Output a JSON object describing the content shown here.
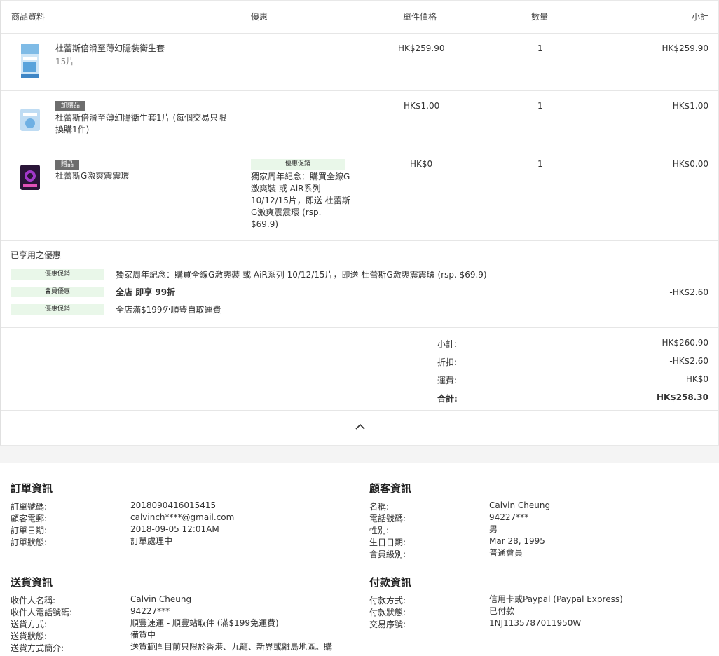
{
  "table_headers": {
    "product": "商品資料",
    "promo": "優惠",
    "unit_price": "單件價格",
    "qty": "數量",
    "subtotal": "小計"
  },
  "items": [
    {
      "name": "杜蕾斯倍滑至薄幻隱裝衛生套",
      "sub": "15片",
      "tag": "",
      "promo_tag": "",
      "promo_text": "",
      "unit_price": "HK$259.90",
      "qty": "1",
      "subtotal": "HK$259.90",
      "image_icon": "condom-box-blue-icon"
    },
    {
      "name": "杜蕾斯倍滑至薄幻隱衛生套1片 (每個交易只限換購1件)",
      "sub": "",
      "tag": "加購品",
      "promo_tag": "",
      "promo_text": "",
      "unit_price": "HK$1.00",
      "qty": "1",
      "subtotal": "HK$1.00",
      "image_icon": "condom-single-blue-icon"
    },
    {
      "name": "杜蕾斯G激爽震震環",
      "sub": "",
      "tag": "贈品",
      "promo_tag": "優惠促銷",
      "promo_text": "獨家周年紀念：購買全線G激爽裝 或 AiR系列10/12/15片，即送 杜蕾斯G激爽震震環 (rsp. $69.9)",
      "unit_price": "HK$0",
      "qty": "1",
      "subtotal": "HK$0.00",
      "image_icon": "vibrating-ring-purple-icon"
    }
  ],
  "applied": {
    "title": "已享用之優惠",
    "rows": [
      {
        "tag": "優惠促銷",
        "desc": "獨家周年紀念：購買全線G激爽裝 或 AiR系列 10/12/15片，即送 杜蕾斯G激爽震震環 (rsp. $69.9)",
        "desc_bold": "",
        "amount": "-"
      },
      {
        "tag": "會員優惠",
        "desc": "",
        "desc_bold": "全店 即享 99折",
        "amount": "-HK$2.60"
      },
      {
        "tag": "優惠促銷",
        "desc": "全店滿$199免順豐自取運費",
        "desc_bold": "",
        "amount": "-"
      }
    ]
  },
  "totals": {
    "subtotal_label": "小計:",
    "subtotal": "HK$260.90",
    "discount_label": "折扣:",
    "discount": "-HK$2.60",
    "shipping_label": "運費:",
    "shipping": "HK$0",
    "total_label": "合計:",
    "total": "HK$258.30"
  },
  "order_info": {
    "title": "訂單資訊",
    "rows": [
      {
        "label": "訂單號碼:",
        "value": "2018090416015415"
      },
      {
        "label": "顧客電郵:",
        "value": "calvinch****@gmail.com"
      },
      {
        "label": "訂單日期:",
        "value": "2018-09-05 12:01AM"
      },
      {
        "label": "訂單狀態:",
        "value": "訂單處理中"
      }
    ]
  },
  "customer_info": {
    "title": "顧客資訊",
    "rows": [
      {
        "label": "名稱:",
        "value": "Calvin Cheung"
      },
      {
        "label": "電話號碼:",
        "value": "94227***"
      },
      {
        "label": "性別:",
        "value": "男"
      },
      {
        "label": "生日日期:",
        "value": "Mar 28, 1995"
      },
      {
        "label": "會員級別:",
        "value": "普通會員"
      }
    ]
  },
  "delivery_info": {
    "title": "送貨資訊",
    "rows": [
      {
        "label": "收件人名稱:",
        "value": "Calvin Cheung"
      },
      {
        "label": "收件人電話號碼:",
        "value": "94227***"
      },
      {
        "label": "送貨方式:",
        "value": "順豐速運 - 順豐站取件 (滿$199免運費)"
      },
      {
        "label": "送貨狀態:",
        "value": "備貨中"
      },
      {
        "label": "送貨方式簡介:",
        "value": "送貨範圍目前只限於香港、九龍、新界或離島地區。購"
      }
    ]
  },
  "payment_info": {
    "title": "付款資訊",
    "rows": [
      {
        "label": "付款方式:",
        "value": "信用卡或Paypal (Paypal Express)"
      },
      {
        "label": "付款狀態:",
        "value": "已付款"
      },
      {
        "label": "交易序號:",
        "value": "1NJ1135787011950W"
      }
    ]
  },
  "icons": {
    "collapse": "chevron-up-icon"
  },
  "colors": {
    "promo_bg": "#e9f7e9",
    "tag_bg": "#6d6d6d"
  }
}
